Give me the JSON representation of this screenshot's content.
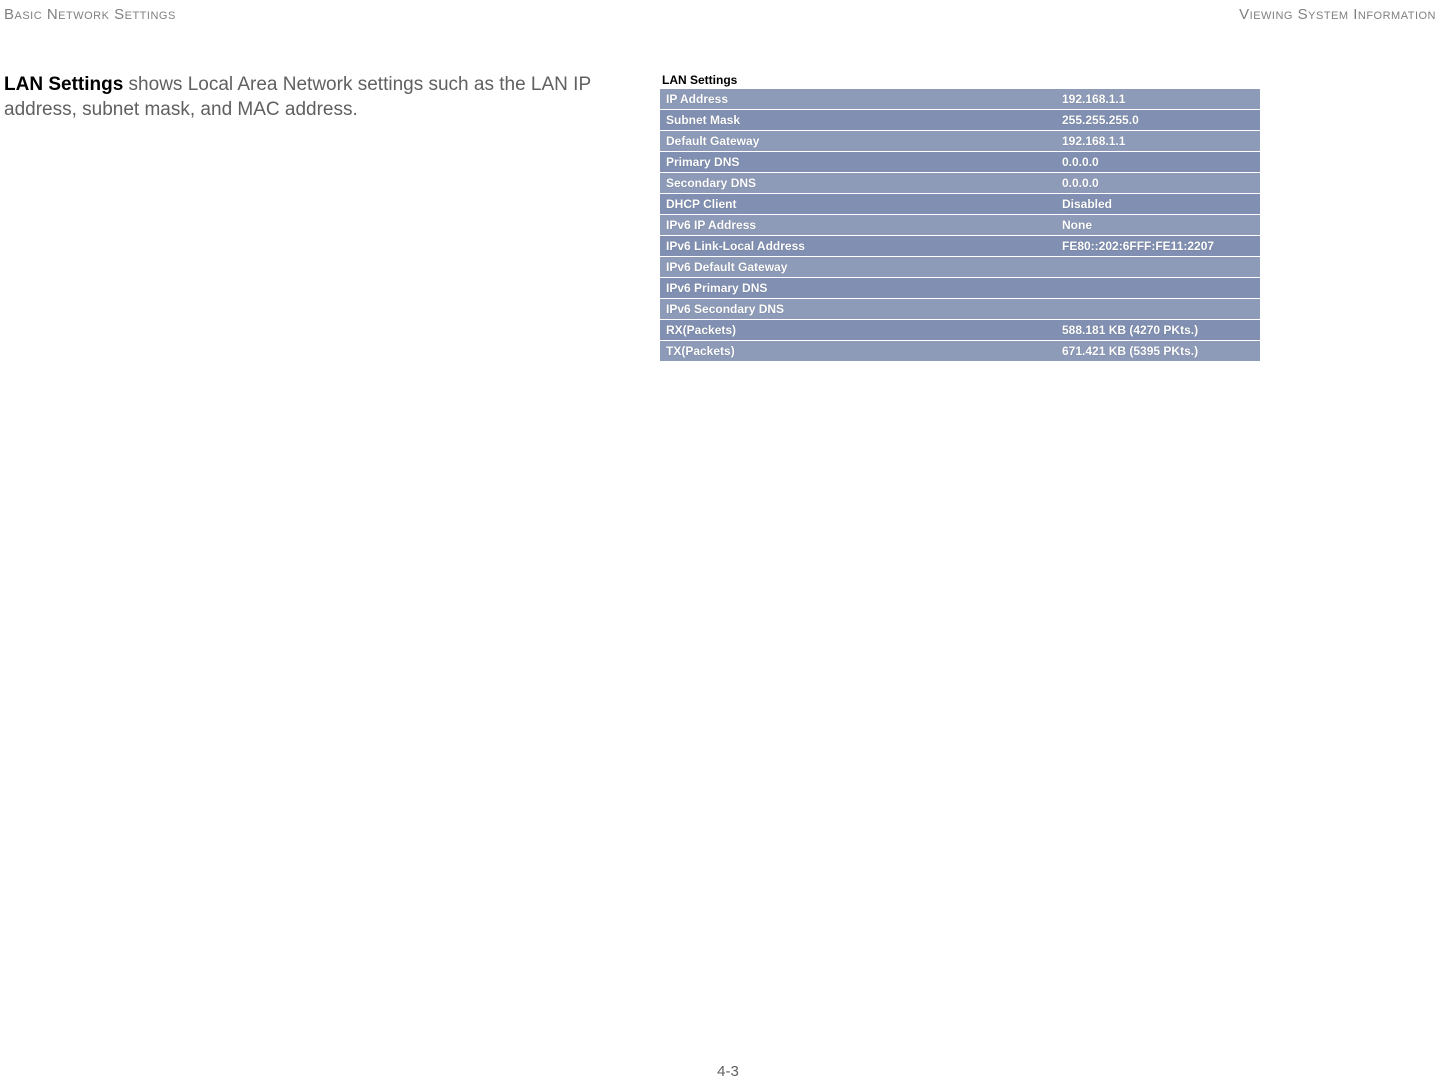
{
  "header": {
    "left": "Basic Network Settings",
    "right": "Viewing System Information"
  },
  "description": {
    "bold": "LAN Settings",
    "rest": "  shows Local Area Network settings such as the LAN IP address, subnet mask, and MAC address."
  },
  "table": {
    "title": "LAN Settings",
    "rows": [
      {
        "label": "IP Address",
        "value": "192.168.1.1"
      },
      {
        "label": "Subnet Mask",
        "value": "255.255.255.0"
      },
      {
        "label": "Default Gateway",
        "value": "192.168.1.1"
      },
      {
        "label": "Primary DNS",
        "value": "0.0.0.0"
      },
      {
        "label": "Secondary DNS",
        "value": "0.0.0.0"
      },
      {
        "label": "DHCP Client",
        "value": "Disabled"
      },
      {
        "label": "IPv6 IP Address",
        "value": "None"
      },
      {
        "label": "IPv6 Link-Local Address",
        "value": "FE80::202:6FFF:FE11:2207"
      },
      {
        "label": "IPv6 Default Gateway",
        "value": ""
      },
      {
        "label": "IPv6 Primary DNS",
        "value": ""
      },
      {
        "label": "IPv6 Secondary DNS",
        "value": ""
      },
      {
        "label": "RX(Packets)",
        "value": "588.181 KB (4270 PKts.)"
      },
      {
        "label": "TX(Packets)",
        "value": "671.421 KB (5395 PKts.)"
      }
    ]
  },
  "page_number": "4-3"
}
